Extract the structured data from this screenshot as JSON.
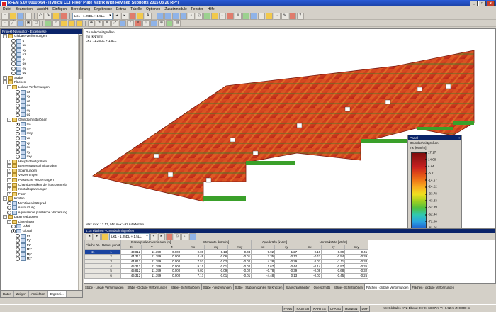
{
  "window": {
    "title": "RFEM 5.07.0000 x64 - [Typical CLT Floor Plate Matrix With Revised Supports 2015 03 20 RP*]"
  },
  "menu": [
    "Datei",
    "Bearbeiten",
    "Ansicht",
    "Einfügen",
    "Berechnung",
    "Ergebnisse",
    "Extras",
    "Tabelle",
    "Optionen",
    "Zusatzmodule",
    "Fenster",
    "Hilfe"
  ],
  "toolbar": {
    "loadcase_combo": "LK1 - 1.25DL + 1.5LL",
    "loadcase_combo2": "LK1 - 1.25DL + 1.5LL"
  },
  "navigator": {
    "title": "Projekt-Navigator - Ergebnisse",
    "items": [
      {
        "label": "Globale Verformungen",
        "indent": 0,
        "exp": "-",
        "icon": "folder"
      },
      {
        "label": "u",
        "indent": 2,
        "radio": false
      },
      {
        "label": "ux",
        "indent": 2,
        "radio": false
      },
      {
        "label": "uy",
        "indent": 2,
        "radio": false
      },
      {
        "label": "uz",
        "indent": 2,
        "radio": false
      },
      {
        "label": "φ",
        "indent": 2,
        "radio": false
      },
      {
        "label": "φx",
        "indent": 2,
        "radio": false
      },
      {
        "label": "φy",
        "indent": 2,
        "radio": false
      },
      {
        "label": "φz",
        "indent": 2,
        "radio": false
      },
      {
        "label": "Stäbe",
        "indent": 0,
        "exp": "+",
        "icon": "folder"
      },
      {
        "label": "Flächen",
        "indent": 0,
        "exp": "-",
        "icon": "folder"
      },
      {
        "label": "Lokale Verformungen",
        "indent": 1,
        "exp": "-",
        "icon": "folder"
      },
      {
        "label": "ux",
        "indent": 3,
        "radio": false
      },
      {
        "label": "uy",
        "indent": 3,
        "radio": false
      },
      {
        "label": "uz",
        "indent": 3,
        "radio": false
      },
      {
        "label": "φx",
        "indent": 3,
        "radio": false
      },
      {
        "label": "φy",
        "indent": 3,
        "radio": false
      },
      {
        "label": "φz",
        "indent": 3,
        "radio": false
      },
      {
        "label": "Grundschnittgrößen",
        "indent": 1,
        "exp": "-",
        "icon": "folder"
      },
      {
        "label": "mx",
        "indent": 3,
        "radio": true
      },
      {
        "label": "my",
        "indent": 3,
        "radio": false
      },
      {
        "label": "mxy",
        "indent": 3,
        "radio": false
      },
      {
        "label": "vx",
        "indent": 3,
        "radio": false
      },
      {
        "label": "vy",
        "indent": 3,
        "radio": false
      },
      {
        "label": "nx",
        "indent": 3,
        "radio": false
      },
      {
        "label": "ny",
        "indent": 3,
        "radio": false
      },
      {
        "label": "nxy",
        "indent": 3,
        "radio": false
      },
      {
        "label": "Hauptschnittgrößen",
        "indent": 1,
        "exp": "+",
        "icon": "folder"
      },
      {
        "label": "Bemessungsschnittgrößen",
        "indent": 1,
        "exp": "+",
        "icon": "folder"
      },
      {
        "label": "Spannungen",
        "indent": 1,
        "exp": "+",
        "icon": "folder"
      },
      {
        "label": "Verzerrungen",
        "indent": 1,
        "exp": "+",
        "icon": "folder"
      },
      {
        "label": "Plastische Verzerrungen",
        "indent": 1,
        "exp": "+",
        "icon": "folder"
      },
      {
        "label": "Charakteristiken der isotropen Flä",
        "indent": 1,
        "exp": "+",
        "icon": "folder"
      },
      {
        "label": "Kontaktspannungen",
        "indent": 1,
        "exp": "+",
        "icon": "folder"
      },
      {
        "label": "Form",
        "indent": 1,
        "exp": "+",
        "icon": "folder"
      },
      {
        "label": "Knoten",
        "indent": 0,
        "exp": "-",
        "icon": "folder"
      },
      {
        "label": "Nichtlinearitätsgrad",
        "indent": 1,
        "radio": false
      },
      {
        "label": "Ausnutzung",
        "indent": 1,
        "radio": false
      },
      {
        "label": "Äquivalente plastische Verzerrung",
        "indent": 1,
        "radio": false
      },
      {
        "label": "Lagerreaktionen",
        "indent": 0,
        "exp": "-",
        "icon": "folder"
      },
      {
        "label": "Linienlager",
        "indent": 1,
        "exp": "-",
        "icon": "folder"
      },
      {
        "label": "Lokal",
        "indent": 2,
        "radio": false
      },
      {
        "label": "Global",
        "indent": 2,
        "radio": true
      },
      {
        "label": "Px'",
        "indent": 3,
        "radio": false
      },
      {
        "label": "Py'",
        "indent": 3,
        "radio": false
      },
      {
        "label": "Pz'",
        "indent": 3,
        "radio": false
      },
      {
        "label": "Mx'",
        "indent": 3,
        "radio": false
      },
      {
        "label": "My'",
        "indent": 3,
        "radio": false
      },
      {
        "label": "Mz'",
        "indent": 3,
        "radio": false
      }
    ],
    "tabs": [
      "Daten",
      "Zeigen",
      "Ansichten",
      "Ergebni..."
    ]
  },
  "view": {
    "result_label": "Grundschnittgrößen",
    "result_sub": "mx [kNm/m]",
    "loadcase": "LK1 : 1.25DL + 1.5LL",
    "footer": "Max m-x: 17.17, Min m-x: -92.64 kNm/m"
  },
  "panel": {
    "title": "Panel",
    "heading": "Grundschnittgrößen",
    "unit": "mx [kNm/m]",
    "ticks": [
      "17.17",
      "14.00",
      "4.44",
      "-5.11",
      "-14.67",
      "-24.22",
      "-33.78",
      "-43.33",
      "-52.89",
      "-62.44",
      "-72.00",
      "-81.56",
      "-92.64"
    ],
    "max_label": "Max :",
    "max_value": "17.17",
    "min_label": "Min :",
    "min_value": "-92.64"
  },
  "table": {
    "title": "4.15 Flächen - Grundschnittgrößen",
    "combo": "LK1 - 1.25DL + 1.5LL",
    "group_headers": [
      "Fläche Nr.",
      "Raster-punkt",
      "Rasterpunkt-Koordinaten [m]",
      "Momente [kNm/m]",
      "Querkräfte [kN/m]",
      "Normalkräfte [kN/m]"
    ],
    "sub_headers": [
      "",
      "",
      "X",
      "Y",
      "Z",
      "mx",
      "my",
      "mxy",
      "vx",
      "vy",
      "nx",
      "ny",
      "nxy"
    ],
    "rows": [
      [
        "41",
        "1",
        "43.812",
        "11.399",
        "0.000",
        "0.00",
        "0.13",
        "0.04",
        "9.92",
        "-1.27",
        "-0.19",
        "-0.69",
        "-0.41"
      ],
      [
        "",
        "2",
        "44.312",
        "11.399",
        "0.000",
        "4.49",
        "-0.06",
        "-0.01",
        "7.35",
        "-0.12",
        "-0.11",
        "-0.54",
        "-0.39"
      ],
      [
        "",
        "3",
        "44.812",
        "11.399",
        "0.000",
        "7.51",
        "-0.02",
        "-0.02",
        "4.28",
        "-0.29",
        "0.07",
        "-1.11",
        "-0.38"
      ],
      [
        "",
        "4",
        "45.312",
        "11.399",
        "0.000",
        "9.10",
        "-0.01",
        "-0.02",
        "1.67",
        "-0.44",
        "-0.14",
        "-0.97",
        "-0.35"
      ],
      [
        "",
        "5",
        "45.812",
        "11.399",
        "0.000",
        "9.03",
        "-0.09",
        "-0.02",
        "-0.78",
        "-0.39",
        "-0.08",
        "-0.68",
        "-0.32"
      ],
      [
        "",
        "6",
        "46.312",
        "11.399",
        "0.000",
        "7.17",
        "-0.01",
        "-0.01",
        "-4.48",
        "0.13",
        "-0.03",
        "-0.45",
        "-0.25"
      ]
    ]
  },
  "sheet_tabs": [
    "Stäbe - Lokale Verformungen",
    "Stäbe - Globale Verformungen",
    "Stäbe - Schnittgrößen",
    "Stäbe - Verzerrungen",
    "Stäbe - Stabkennzahlen für Knicken",
    "Stabschlankheiten",
    "Querschnitts",
    "Stäbe - Schnittgrößen",
    "Flächen - globale Verformungen",
    "Flächen - globale Verformungen"
  ],
  "status": {
    "modes": [
      "FANG",
      "RASTER",
      "KARTES",
      "OFANG",
      "HLINIEN",
      "DXF"
    ],
    "coords": "KS: Globales XYZ  Ebene: XY    X: 68.07 m   Y: -6.92 m   Z: 0.000 m"
  },
  "colors": {
    "legend": [
      "#1a2a9a",
      "#2060d0",
      "#2aa4e0",
      "#30c8b0",
      "#50c040",
      "#a0d020",
      "#f0e020",
      "#f8b020",
      "#f07a18",
      "#e04a18",
      "#c82020",
      "#a01818",
      "#800c0c"
    ]
  }
}
